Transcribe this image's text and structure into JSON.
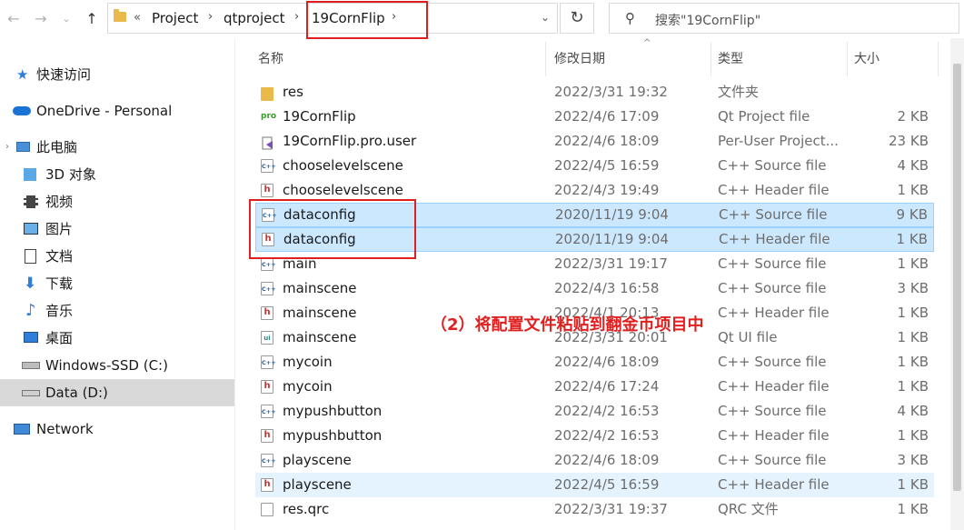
{
  "toolbar": {
    "back_icon": "arrow-left-icon",
    "forward_icon": "arrow-right-icon",
    "recent_icon": "chevron-down-icon",
    "up_icon": "arrow-up-icon",
    "breadcrumb_prefix": "«",
    "breadcrumbs": [
      "Project",
      "qtproject",
      "19CornFlip"
    ],
    "search_placeholder": "搜索\"19CornFlip\""
  },
  "sidebar": {
    "items": [
      {
        "label": "快速访问",
        "icon": "star-icon"
      },
      {
        "label": "OneDrive - Personal",
        "icon": "cloud-icon"
      },
      {
        "label": "此电脑",
        "icon": "computer-icon"
      },
      {
        "label": "3D 对象",
        "icon": "cube-icon"
      },
      {
        "label": "视频",
        "icon": "video-icon"
      },
      {
        "label": "图片",
        "icon": "picture-icon"
      },
      {
        "label": "文档",
        "icon": "document-icon"
      },
      {
        "label": "下载",
        "icon": "download-icon"
      },
      {
        "label": "音乐",
        "icon": "music-icon"
      },
      {
        "label": "桌面",
        "icon": "desktop-icon"
      },
      {
        "label": "Windows-SSD (C:)",
        "icon": "drive-icon"
      },
      {
        "label": "Data (D:)",
        "icon": "drive-icon"
      },
      {
        "label": "Network",
        "icon": "network-icon"
      }
    ]
  },
  "columns": {
    "name": "名称",
    "date": "修改日期",
    "type": "类型",
    "size": "大小"
  },
  "files": [
    {
      "name": "res",
      "date": "2022/3/31 19:32",
      "type": "文件夹",
      "size": "",
      "icon": "folder-icon"
    },
    {
      "name": "19CornFlip",
      "date": "2022/4/6 17:09",
      "type": "Qt Project file",
      "size": "2 KB",
      "icon": "pro-file-icon"
    },
    {
      "name": "19CornFlip.pro.user",
      "date": "2022/4/6 18:09",
      "type": "Per-User Project...",
      "size": "23 KB",
      "icon": "user-file-icon"
    },
    {
      "name": "chooselevelscene",
      "date": "2022/4/5 16:59",
      "type": "C++ Source file",
      "size": "4 KB",
      "icon": "cpp-file-icon"
    },
    {
      "name": "chooselevelscene",
      "date": "2022/4/3 19:49",
      "type": "C++ Header file",
      "size": "1 KB",
      "icon": "header-file-icon"
    },
    {
      "name": "dataconfig",
      "date": "2020/11/19 9:04",
      "type": "C++ Source file",
      "size": "9 KB",
      "icon": "cpp-file-icon"
    },
    {
      "name": "dataconfig",
      "date": "2020/11/19 9:04",
      "type": "C++ Header file",
      "size": "1 KB",
      "icon": "header-file-icon"
    },
    {
      "name": "main",
      "date": "2022/3/31 19:17",
      "type": "C++ Source file",
      "size": "1 KB",
      "icon": "cpp-file-icon"
    },
    {
      "name": "mainscene",
      "date": "2022/4/3 16:58",
      "type": "C++ Source file",
      "size": "3 KB",
      "icon": "cpp-file-icon"
    },
    {
      "name": "mainscene",
      "date": "2022/4/1 20:13",
      "type": "C++ Header file",
      "size": "1 KB",
      "icon": "header-file-icon"
    },
    {
      "name": "mainscene",
      "date": "2022/3/31 20:01",
      "type": "Qt UI file",
      "size": "1 KB",
      "icon": "ui-file-icon"
    },
    {
      "name": "mycoin",
      "date": "2022/4/6 18:09",
      "type": "C++ Source file",
      "size": "1 KB",
      "icon": "cpp-file-icon"
    },
    {
      "name": "mycoin",
      "date": "2022/4/6 17:24",
      "type": "C++ Header file",
      "size": "1 KB",
      "icon": "header-file-icon"
    },
    {
      "name": "mypushbutton",
      "date": "2022/4/2 16:53",
      "type": "C++ Source file",
      "size": "4 KB",
      "icon": "cpp-file-icon"
    },
    {
      "name": "mypushbutton",
      "date": "2022/4/2 16:53",
      "type": "C++ Header file",
      "size": "1 KB",
      "icon": "header-file-icon"
    },
    {
      "name": "playscene",
      "date": "2022/4/6 18:09",
      "type": "C++ Source file",
      "size": "3 KB",
      "icon": "cpp-file-icon"
    },
    {
      "name": "playscene",
      "date": "2022/4/5 16:59",
      "type": "C++ Header file",
      "size": "1 KB",
      "icon": "header-file-icon"
    },
    {
      "name": "res.qrc",
      "date": "2022/3/31 19:37",
      "type": "QRC 文件",
      "size": "1 KB",
      "icon": "qrc-file-icon"
    }
  ],
  "annotation": "（2）将配置文件粘贴到翻金币项目中",
  "colors": {
    "selection": "#cce8ff",
    "highlight_red": "#e02020",
    "folder": "#e9b949"
  }
}
